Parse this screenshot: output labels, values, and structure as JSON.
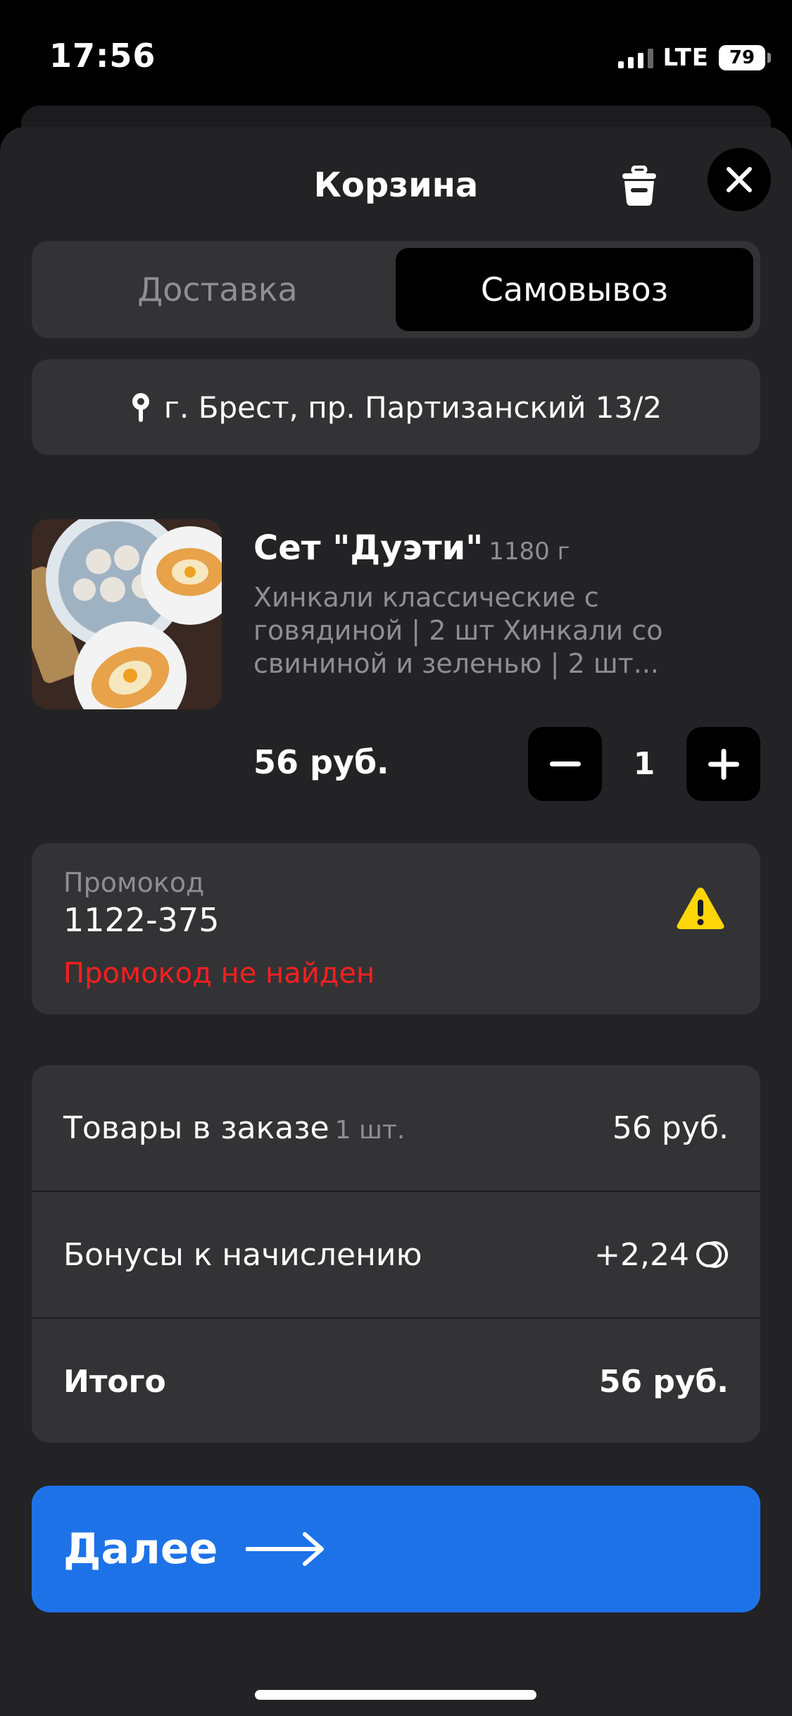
{
  "status": {
    "time": "17:56",
    "network": "LTE",
    "battery": "79"
  },
  "cart": {
    "title": "Корзина",
    "tabs": {
      "delivery": "Доставка",
      "pickup": "Самовывоз"
    },
    "address": "г. Брест, пр. Партизанский 13/2"
  },
  "product": {
    "name": "Сет \"Дуэти\"",
    "weight": "1180 г",
    "description_lines": [
      "Хинкали классические с",
      "говядиной | 2 шт Хинкали со",
      "свининой и зеленью | 2 шт..."
    ],
    "price": "56 руб.",
    "quantity": "1"
  },
  "promo": {
    "label": "Промокод",
    "value": "1122-375",
    "error": "Промокод не найден"
  },
  "summary": {
    "items_label": "Товары в заказе",
    "items_count": "1 шт.",
    "items_value": "56 руб.",
    "bonus_label": "Бонусы к начислению",
    "bonus_value": "+2,24",
    "total_label": "Итого",
    "total_value": "56 руб."
  },
  "next_button": {
    "label": "Далее"
  },
  "colors": {
    "accent": "#1e72e8",
    "error": "#ff1f1f",
    "warning": "#ffd60a",
    "card": "#333335",
    "sheet": "#232325"
  },
  "icons": [
    "trash-icon",
    "close-icon",
    "location-pin-icon",
    "minus-icon",
    "plus-icon",
    "warning-icon",
    "bonus-coin-icon",
    "arrow-right-icon"
  ]
}
